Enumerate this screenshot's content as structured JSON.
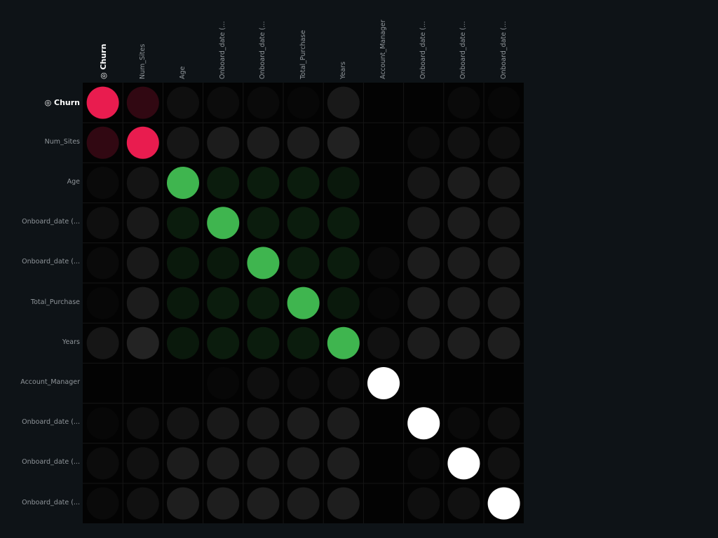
{
  "chart_data": {
    "type": "heatmap",
    "variables": [
      "◎ Churn",
      "Num_Sites",
      "Age",
      "Onboard_date (...",
      "Onboard_date (...",
      "Total_Purchase",
      "Years",
      "Account_Manager",
      "Onboard_date (...",
      "Onboard_date (...",
      "Onboard_date (..."
    ],
    "col_labels": [
      "◎ Churn",
      "Num_Sites",
      "Age",
      "Onboard_date (...",
      "Onboard_date (...",
      "Total_Purchase",
      "Years",
      "Account_Manager",
      "Onboard_date (...",
      "Onboard_date (...",
      "Onboard_date (..."
    ],
    "target_index": 0,
    "value_range": [
      0,
      1
    ],
    "colors": {
      "target": "#e91c4f",
      "numeric": "#3fb54f",
      "categorical": "#ffffff",
      "neutral": "#ffffff",
      "panel_bg": "#030303",
      "page_bg": "#0e1317"
    },
    "groups": [
      "target",
      "target",
      "numeric",
      "numeric",
      "numeric",
      "numeric",
      "numeric",
      "categorical",
      "categorical",
      "categorical",
      "categorical"
    ],
    "matrix": [
      [
        1.0,
        0.2,
        0.05,
        0.04,
        0.03,
        0.02,
        0.09,
        0.0,
        0.0,
        0.03,
        0.02
      ],
      [
        0.2,
        1.0,
        0.08,
        0.1,
        0.1,
        0.1,
        0.12,
        0.0,
        0.04,
        0.06,
        0.05
      ],
      [
        0.03,
        0.07,
        1.0,
        0.14,
        0.14,
        0.14,
        0.12,
        0.0,
        0.08,
        0.1,
        0.09
      ],
      [
        0.05,
        0.09,
        0.14,
        1.0,
        0.14,
        0.14,
        0.14,
        0.0,
        0.09,
        0.1,
        0.09
      ],
      [
        0.03,
        0.09,
        0.13,
        0.13,
        1.0,
        0.14,
        0.14,
        0.03,
        0.1,
        0.1,
        0.1
      ],
      [
        0.02,
        0.1,
        0.13,
        0.14,
        0.14,
        1.0,
        0.13,
        0.02,
        0.1,
        0.1,
        0.1
      ],
      [
        0.08,
        0.13,
        0.13,
        0.14,
        0.14,
        0.14,
        1.0,
        0.06,
        0.1,
        0.11,
        0.11
      ],
      [
        0.0,
        0.0,
        0.0,
        0.02,
        0.05,
        0.04,
        0.05,
        1.0,
        0.0,
        0.0,
        0.0
      ],
      [
        0.02,
        0.05,
        0.07,
        0.09,
        0.09,
        0.1,
        0.1,
        0.0,
        1.0,
        0.03,
        0.05
      ],
      [
        0.04,
        0.06,
        0.1,
        0.1,
        0.1,
        0.1,
        0.11,
        0.0,
        0.03,
        1.0,
        0.06
      ],
      [
        0.03,
        0.06,
        0.11,
        0.11,
        0.11,
        0.1,
        0.11,
        0.0,
        0.05,
        0.06,
        1.0
      ]
    ],
    "grid": true,
    "legend": "none"
  }
}
